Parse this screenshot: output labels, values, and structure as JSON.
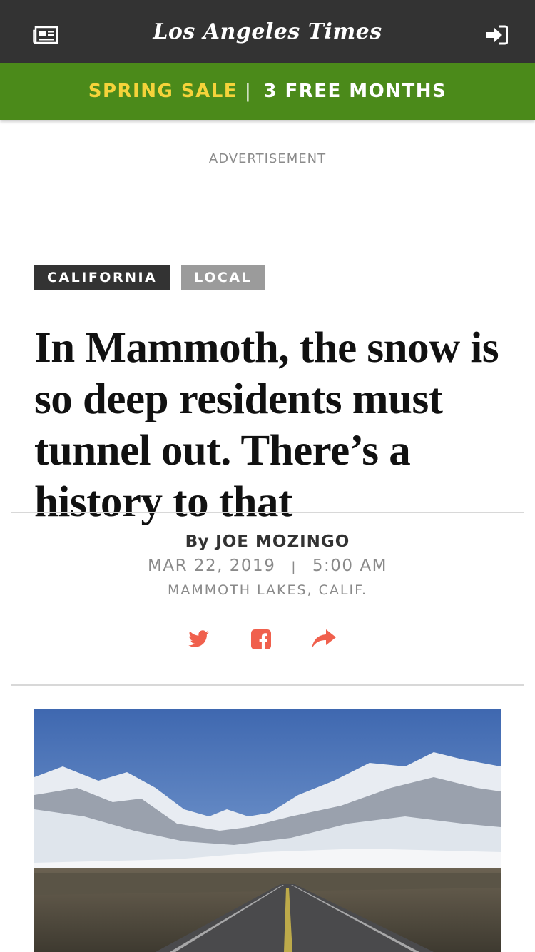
{
  "header": {
    "masthead": "Los Angeles Times",
    "left_icon": "newspaper-icon",
    "right_icon": "sign-in-icon"
  },
  "promo": {
    "sale_label": "SPRING SALE",
    "separator": "|",
    "offer_label": "3 FREE MONTHS",
    "colors": {
      "background": "#4b8a1a",
      "sale": "#f5d33a",
      "offer": "#ffffff"
    }
  },
  "advertisement_label": "ADVERTISEMENT",
  "article": {
    "tags": [
      "CALIFORNIA",
      "LOCAL"
    ],
    "headline": "In Mammoth, the snow is so deep residents must tunnel out. There’s a history to that",
    "byline_prefix": "By",
    "author": "JOE MOZINGO",
    "date": "MAR 22, 2019",
    "date_separator": "|",
    "time": "5:00 AM",
    "location": "MAMMOTH LAKES, CALIF."
  },
  "share": {
    "icons": [
      "twitter-icon",
      "facebook-icon",
      "share-icon"
    ],
    "color": "#f0604d"
  }
}
